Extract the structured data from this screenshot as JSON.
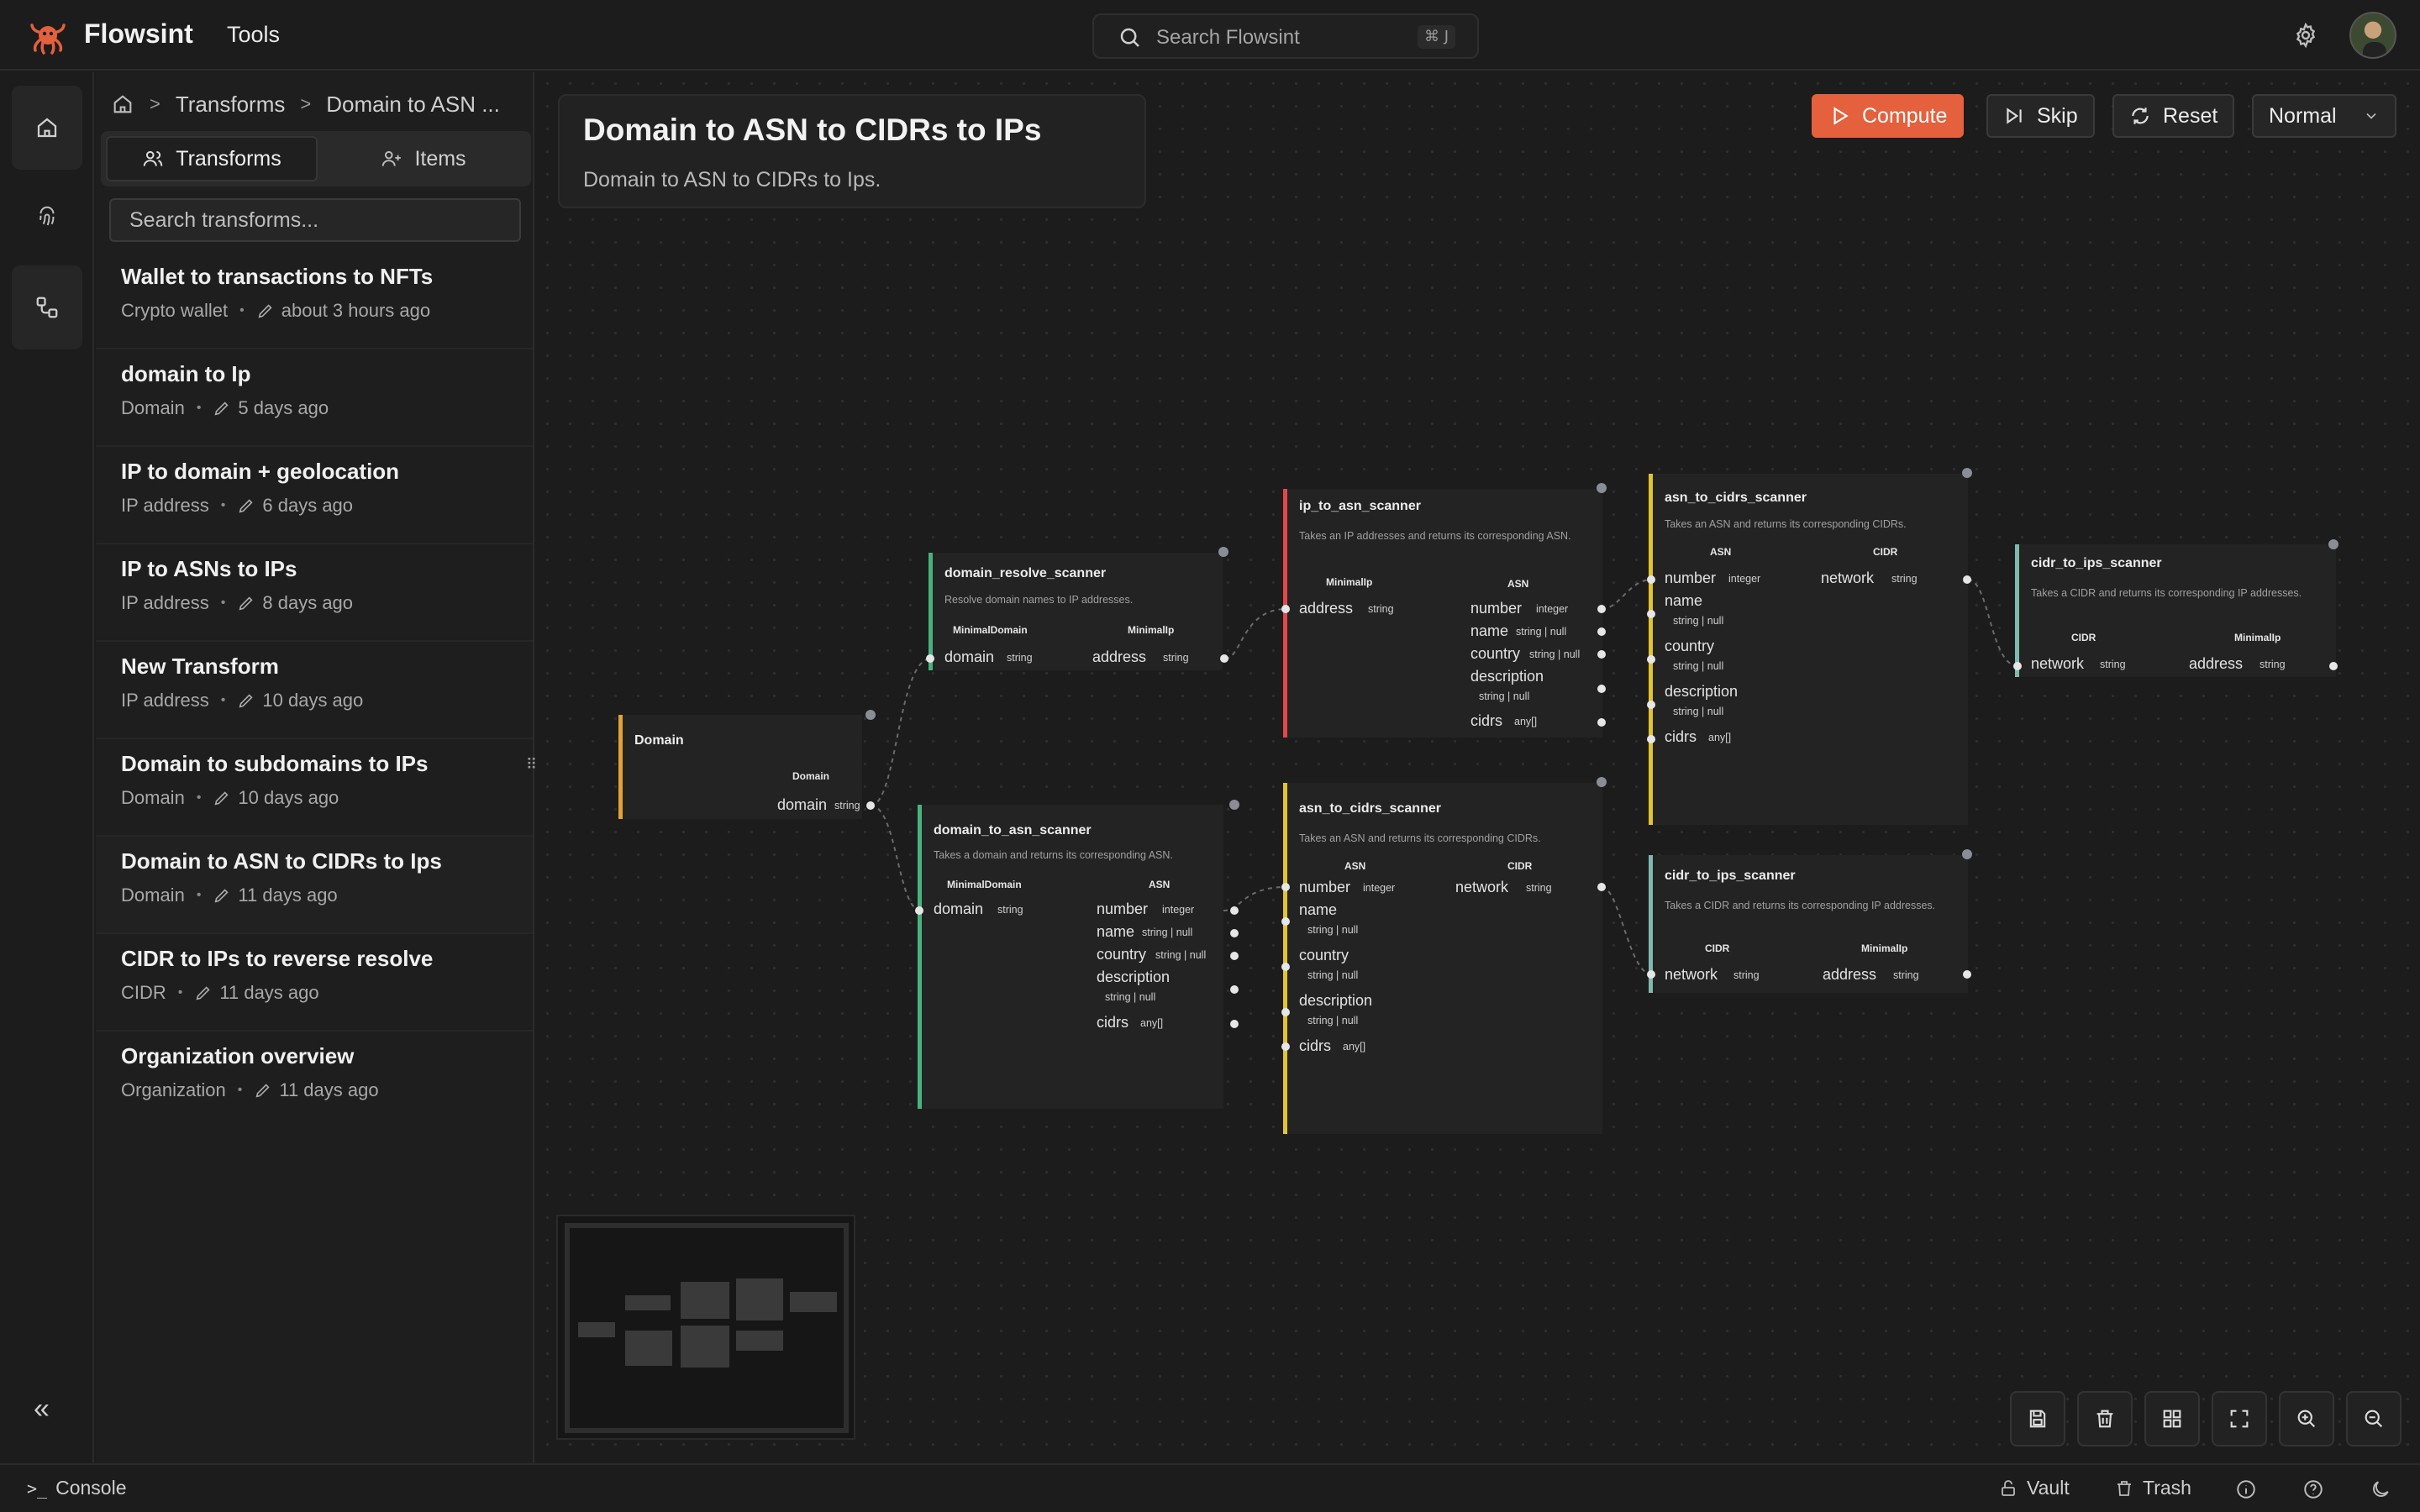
{
  "app": {
    "name": "Flowsint",
    "accent": "#e5603c"
  },
  "topbar": {
    "menu_tools": "Tools",
    "search_placeholder": "Search Flowsint",
    "search_shortcut": "⌘ J"
  },
  "breadcrumb": {
    "level1": "Transforms",
    "level2": "Domain to ASN ..."
  },
  "panel": {
    "tab_transforms": "Transforms",
    "tab_items": "Items",
    "search_placeholder": "Search transforms...",
    "items": [
      {
        "title": "Wallet to transactions to NFTs",
        "type": "Crypto wallet",
        "time": "about 3 hours ago"
      },
      {
        "title": "domain to Ip",
        "type": "Domain",
        "time": "5 days ago"
      },
      {
        "title": "IP to domain + geolocation",
        "type": "IP address",
        "time": "6 days ago"
      },
      {
        "title": "IP to ASNs to IPs",
        "type": "IP address",
        "time": "8 days ago"
      },
      {
        "title": "New Transform",
        "type": "IP address",
        "time": "10 days ago"
      },
      {
        "title": "Domain to subdomains to IPs",
        "type": "Domain",
        "time": "10 days ago"
      },
      {
        "title": "Domain to ASN to CIDRs to Ips",
        "type": "Domain",
        "time": "11 days ago"
      },
      {
        "title": "CIDR to IPs to reverse resolve",
        "type": "CIDR",
        "time": "11 days ago"
      },
      {
        "title": "Organization overview",
        "type": "Organization",
        "time": "11 days ago"
      }
    ]
  },
  "flow": {
    "title": "Domain to ASN to CIDRs to IPs",
    "description": "Domain to ASN to CIDRs to Ips."
  },
  "toolbar": {
    "compute": "Compute",
    "skip": "Skip",
    "reset": "Reset",
    "mode": "Normal"
  },
  "types": {
    "string": "string",
    "integer": "integer",
    "string_null": "string | null",
    "any_array": "any[]"
  },
  "nodes": {
    "domain": {
      "title": "Domain",
      "out_label": "Domain",
      "out_field": "domain"
    },
    "domain_resolve": {
      "title": "domain_resolve_scanner",
      "desc": "Resolve domain names to IP addresses.",
      "in_label": "MinimalDomain",
      "out_label": "MinimalIp",
      "in_field": "domain",
      "out_field": "address"
    },
    "domain_to_asn": {
      "title": "domain_to_asn_scanner",
      "desc": "Takes a domain and returns its corresponding ASN.",
      "in_label": "MinimalDomain",
      "out_label": "ASN",
      "in_field": "domain",
      "out_fields": [
        "number",
        "name",
        "country",
        "description",
        "cidrs"
      ]
    },
    "ip_to_asn": {
      "title": "ip_to_asn_scanner",
      "desc": "Takes an IP addresses and returns its corresponding ASN.",
      "in_label": "MinimalIp",
      "out_label": "ASN",
      "in_field": "address",
      "out_fields": [
        "number",
        "name",
        "country",
        "description",
        "cidrs"
      ]
    },
    "asn_to_cidrs_1": {
      "title": "asn_to_cidrs_scanner",
      "desc": "Takes an ASN and returns its corresponding CIDRs.",
      "in_label": "ASN",
      "out_label": "CIDR",
      "in_fields": [
        "number",
        "name",
        "country",
        "description",
        "cidrs"
      ],
      "out_field": "network"
    },
    "asn_to_cidrs_2": {
      "title": "asn_to_cidrs_scanner",
      "desc": "Takes an ASN and returns its corresponding CIDRs.",
      "in_label": "ASN",
      "out_label": "CIDR",
      "in_fields": [
        "number",
        "name",
        "country",
        "description",
        "cidrs"
      ],
      "out_field": "network"
    },
    "cidr_to_ips_1": {
      "title": "cidr_to_ips_scanner",
      "desc": "Takes a CIDR and returns its corresponding IP addresses.",
      "in_label": "CIDR",
      "out_label": "MinimalIp",
      "in_field": "network",
      "out_field": "address"
    },
    "cidr_to_ips_2": {
      "title": "cidr_to_ips_scanner",
      "desc": "Takes a CIDR and returns its corresponding IP addresses.",
      "in_label": "CIDR",
      "out_label": "MinimalIp",
      "in_field": "network",
      "out_field": "address"
    }
  },
  "statusbar": {
    "console": "Console",
    "vault": "Vault",
    "trash": "Trash"
  }
}
